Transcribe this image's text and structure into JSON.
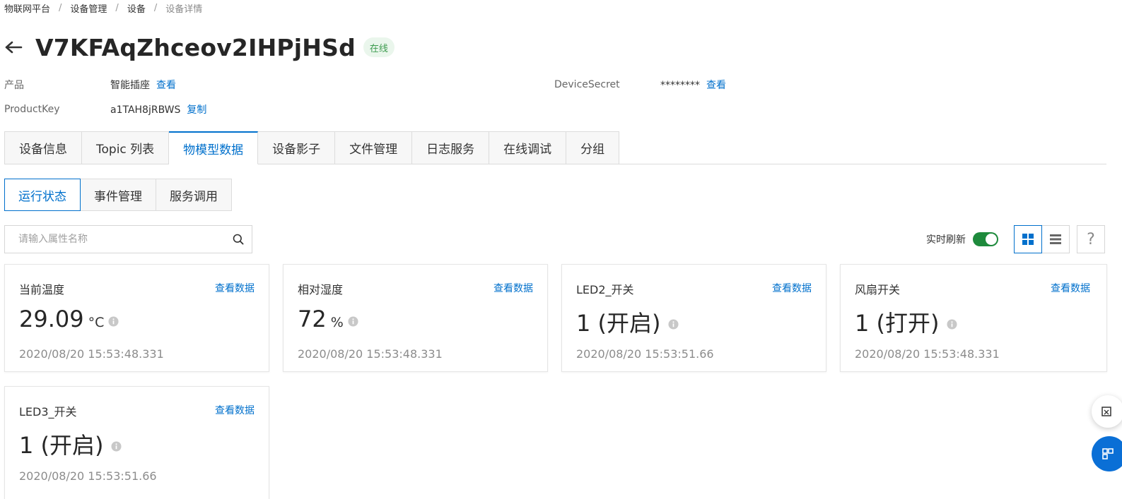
{
  "breadcrumb": [
    "物联网平台",
    "设备管理",
    "设备",
    "设备详情"
  ],
  "breadcrumb_separator": "/",
  "device": {
    "name": "V7KFAqZhceov2IHPjHSd",
    "status": "在线"
  },
  "meta": {
    "product_label": "产品",
    "product_value": "智能插座",
    "product_link": "查看",
    "productkey_label": "ProductKey",
    "productkey_value": "a1TAH8jRBWS",
    "productkey_link": "复制",
    "secret_label": "DeviceSecret",
    "secret_value": "********",
    "secret_link": "查看"
  },
  "tabs": [
    "设备信息",
    "Topic 列表",
    "物模型数据",
    "设备影子",
    "文件管理",
    "日志服务",
    "在线调试",
    "分组"
  ],
  "active_tab": "物模型数据",
  "subtabs": [
    "运行状态",
    "事件管理",
    "服务调用"
  ],
  "active_subtab": "运行状态",
  "search": {
    "placeholder": "请输入属性名称"
  },
  "toolbar": {
    "realtime_label": "实时刷新",
    "realtime_on": true,
    "help": "?"
  },
  "cards": [
    {
      "title": "当前温度",
      "link": "查看数据",
      "value": "29.09",
      "unit": "°C",
      "time": "2020/08/20 15:53:48.331"
    },
    {
      "title": "相对湿度",
      "link": "查看数据",
      "value": "72",
      "unit": "%",
      "time": "2020/08/20 15:53:48.331"
    },
    {
      "title": "LED2_开关",
      "link": "查看数据",
      "value": "1 (开启)",
      "unit": "",
      "time": "2020/08/20 15:53:51.66"
    },
    {
      "title": "风扇开关",
      "link": "查看数据",
      "value": "1 (打开)",
      "unit": "",
      "time": "2020/08/20 15:53:48.331"
    },
    {
      "title": "LED3_开关",
      "link": "查看数据",
      "value": "1 (开启)",
      "unit": "",
      "time": "2020/08/20 15:53:51.66"
    }
  ],
  "colors": {
    "accent": "#0070cc",
    "online_bg": "#eaf6ec",
    "online_text": "#3d9b4f",
    "toggle_on": "#1e8a3c"
  },
  "icons": {
    "back": "arrow-left-icon",
    "search": "search-icon",
    "grid_view": "grid-view-icon",
    "list_view": "list-view-icon",
    "info": "info-icon"
  }
}
